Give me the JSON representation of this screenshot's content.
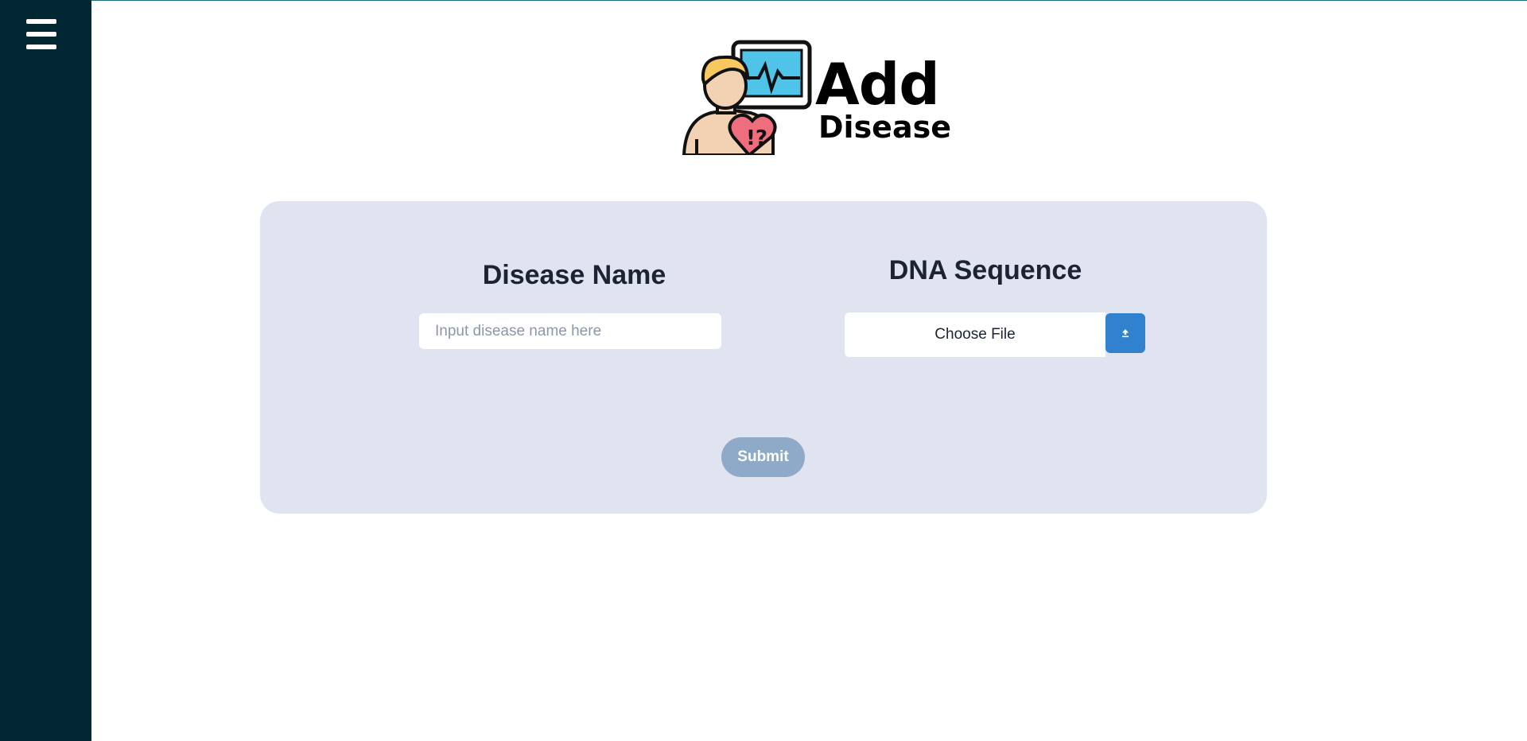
{
  "sidebar": {
    "menu_icon": "hamburger-menu-icon"
  },
  "logo": {
    "title": "Add",
    "subtitle": "Disease",
    "icon": "patient-heart-monitor-icon"
  },
  "form": {
    "disease_name": {
      "label": "Disease Name",
      "placeholder": "Input disease name here",
      "value": ""
    },
    "dna_sequence": {
      "label": "DNA Sequence",
      "file_button_label": "Choose File",
      "upload_icon": "upload-icon"
    },
    "submit_label": "Submit"
  },
  "colors": {
    "sidebar": "#032633",
    "card": "#e0e4f0",
    "upload_button": "#3182ce",
    "submit_button": "#8fa9c9",
    "heading": "#1d2333"
  }
}
